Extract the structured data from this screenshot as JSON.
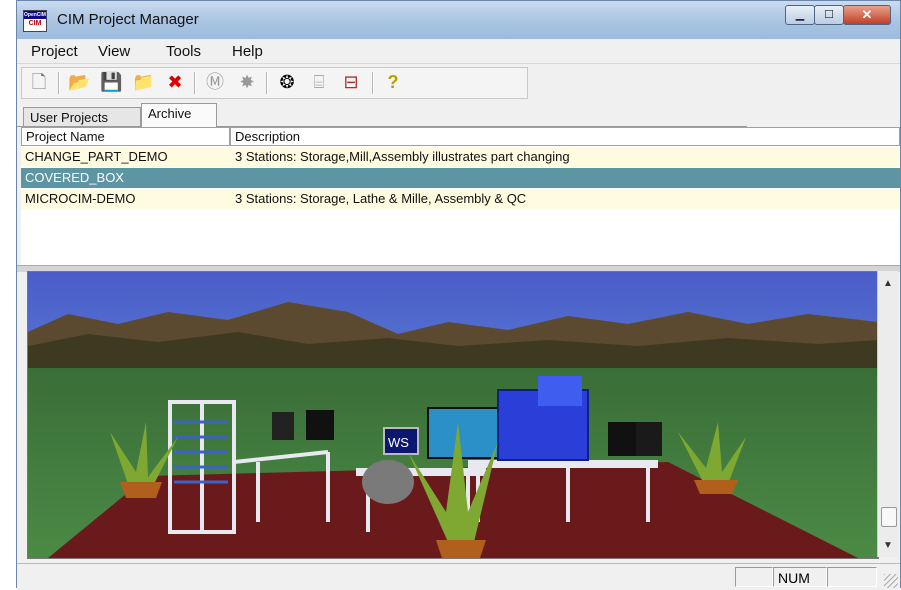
{
  "window": {
    "title": "CIM Project Manager",
    "icon_label_top": "OpenCIM"
  },
  "menubar": {
    "items": [
      "Project",
      "View",
      "Tools",
      "Help"
    ]
  },
  "toolbar": {
    "buttons": [
      {
        "name": "new-icon",
        "glyph": "🗋"
      },
      {
        "name": "open-icon",
        "glyph": "📂"
      },
      {
        "name": "save-icon",
        "glyph": "💾"
      },
      {
        "name": "folder-icon",
        "glyph": "📁"
      },
      {
        "name": "delete-icon",
        "glyph": "✖"
      },
      {
        "name": "machine-icon",
        "glyph": "Ⓜ"
      },
      {
        "name": "burst-icon",
        "glyph": "✸"
      },
      {
        "name": "robot-icon",
        "glyph": "❂"
      },
      {
        "name": "export-icon",
        "glyph": "⌸"
      },
      {
        "name": "import-icon",
        "glyph": "⊟"
      },
      {
        "name": "help-icon",
        "glyph": "?"
      }
    ]
  },
  "tabs": [
    {
      "label": "User Projects",
      "active": false
    },
    {
      "label": "Archive",
      "active": true
    }
  ],
  "table": {
    "columns": [
      "Project Name",
      "Description"
    ],
    "rows": [
      {
        "name": "CHANGE_PART_DEMO",
        "description": "3 Stations: Storage,Mill,Assembly illustrates part changing",
        "selected": false
      },
      {
        "name": "COVERED_BOX",
        "description": "",
        "selected": true
      },
      {
        "name": "MICROCIM-DEMO",
        "description": "3 Stations: Storage, Lathe & Mille, Assembly & QC",
        "selected": false
      }
    ]
  },
  "viewport": {
    "station_label": "WS"
  },
  "scrollbar": {
    "up": "▲",
    "down": "▼",
    "position_fraction": 0.92
  },
  "statusbar": {
    "num": "NUM"
  },
  "colors": {
    "selected_row": "#5e95a3",
    "row_bg": "#fffbe0",
    "sky": "#3a5fc8",
    "ground": "#3e7a3a",
    "carpet": "#6a1a1a"
  }
}
